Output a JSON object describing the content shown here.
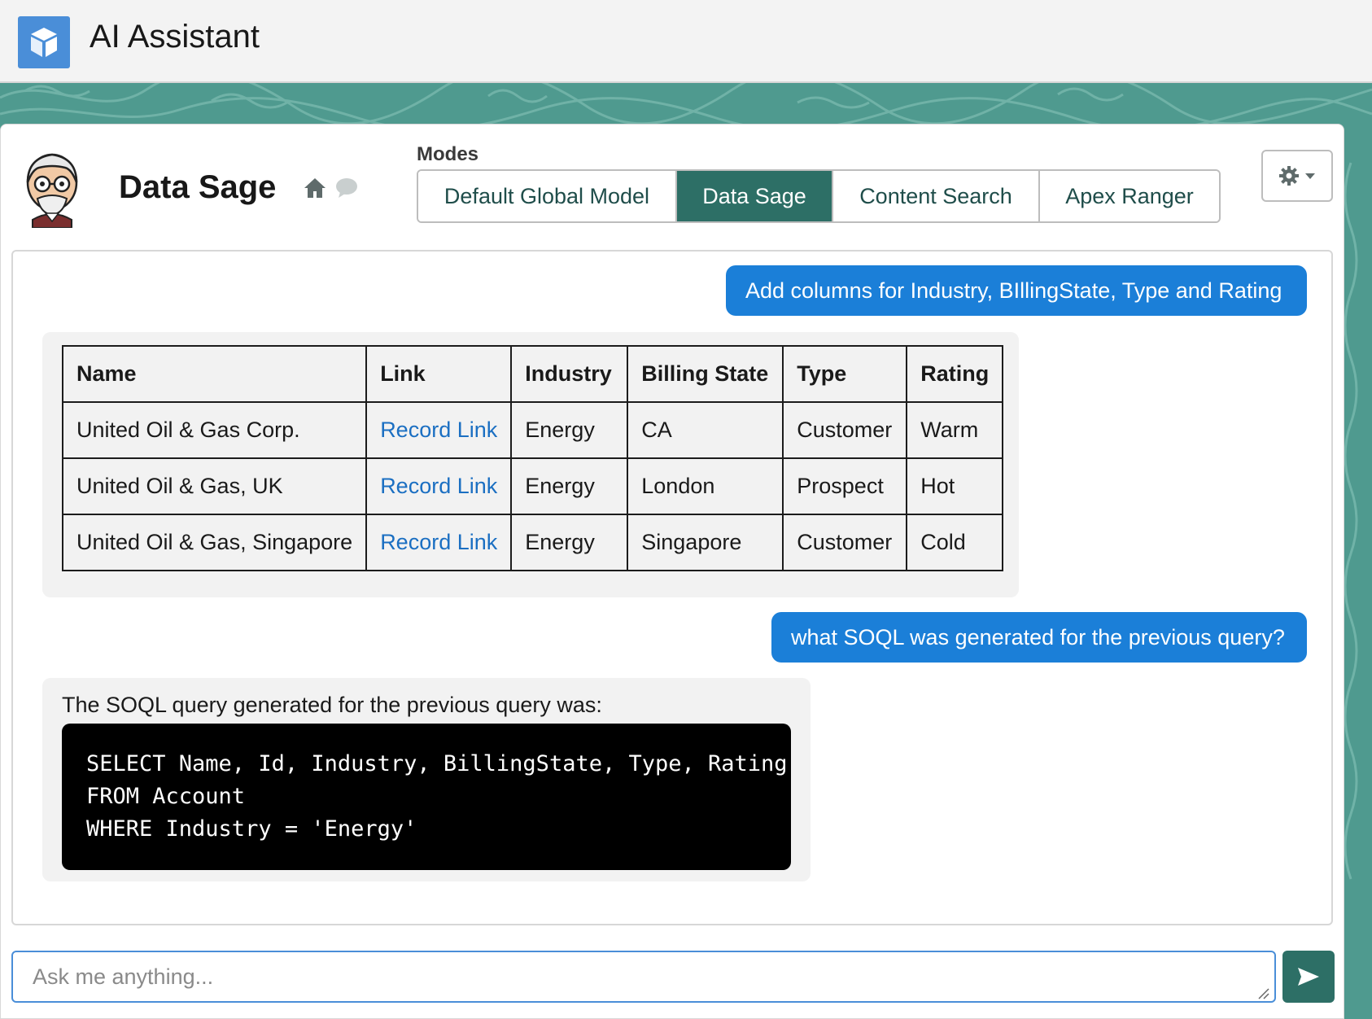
{
  "app": {
    "title": "AI Assistant"
  },
  "assistant": {
    "name": "Data Sage"
  },
  "modes": {
    "label": "Modes",
    "options": [
      "Default Global Model",
      "Data Sage",
      "Content Search",
      "Apex Ranger"
    ],
    "active": "Data Sage"
  },
  "messages": {
    "user_1": "Add columns for Industry, BIllingState, Type and Rating",
    "table": {
      "headers": [
        "Name",
        "Link",
        "Industry",
        "Billing State",
        "Type",
        "Rating"
      ],
      "rows": [
        [
          "United Oil & Gas Corp.",
          "Record Link",
          "Energy",
          "CA",
          "Customer",
          "Warm"
        ],
        [
          "United Oil & Gas, UK",
          "Record Link",
          "Energy",
          "London",
          "Prospect",
          "Hot"
        ],
        [
          "United Oil & Gas, Singapore",
          "Record Link",
          "Energy",
          "Singapore",
          "Customer",
          "Cold"
        ]
      ]
    },
    "user_2": "what SOQL was generated for the previous query?",
    "bot_2": {
      "intro": "The SOQL query generated for the previous query was:",
      "code": [
        "SELECT Name, Id, Industry, BillingState, Type, Rating",
        "FROM Account",
        "WHERE Industry = 'Energy'"
      ]
    }
  },
  "input": {
    "placeholder": "Ask me anything...",
    "value": ""
  },
  "colors": {
    "header_bg": "#f3f3f3",
    "brand_blue": "#4a8ed8",
    "teal_active": "#2d6f66",
    "user_bubble": "#1b7fd8",
    "link": "#1b6fc2",
    "background_teal": "#4f9a8f"
  },
  "icons": {
    "app_logo": "cube-icon",
    "home": "home-icon",
    "chat": "chat-bubble-icon",
    "settings": "gear-icon",
    "dropdown": "chevron-down-icon",
    "send": "send-icon"
  }
}
